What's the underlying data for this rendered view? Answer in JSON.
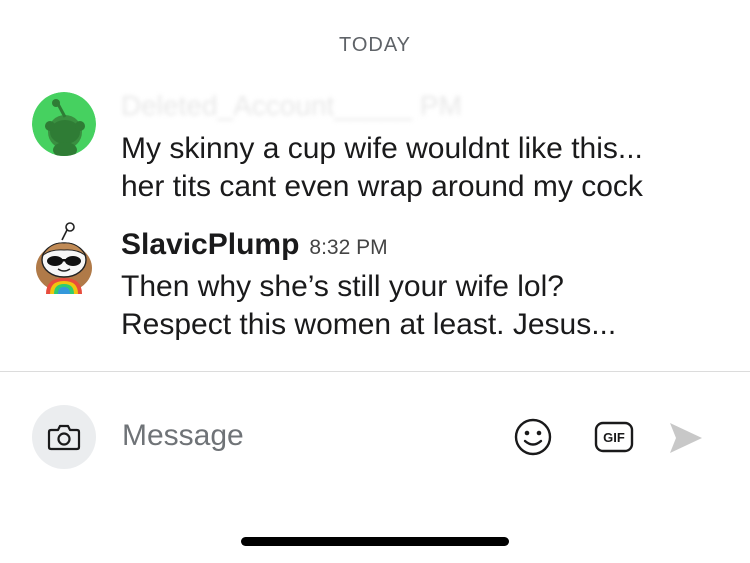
{
  "date_divider": "TODAY",
  "messages": [
    {
      "username": "Deleted_Account_____ PM",
      "timestamp": "",
      "text": "My skinny a cup wife wouldnt like this...\nher tits cant even wrap around my cock",
      "avatar_icon": "reddit-snoo-green-avatar-icon"
    },
    {
      "username": "SlavicPlump",
      "timestamp": "8:32 PM",
      "text": "Then why she’s still your wife lol?\nRespect this women at least. Jesus...",
      "avatar_icon": "snoo-sunglasses-avatar-icon"
    }
  ],
  "composer": {
    "placeholder": "Message",
    "camera_icon": "camera-icon",
    "emoji_icon": "emoji-icon",
    "gif_label": "GIF",
    "send_icon": "send-icon"
  },
  "colors": {
    "avatar_green": "#46d160",
    "muted_text": "#6f7377",
    "send_disabled": "#c8c8c8"
  }
}
